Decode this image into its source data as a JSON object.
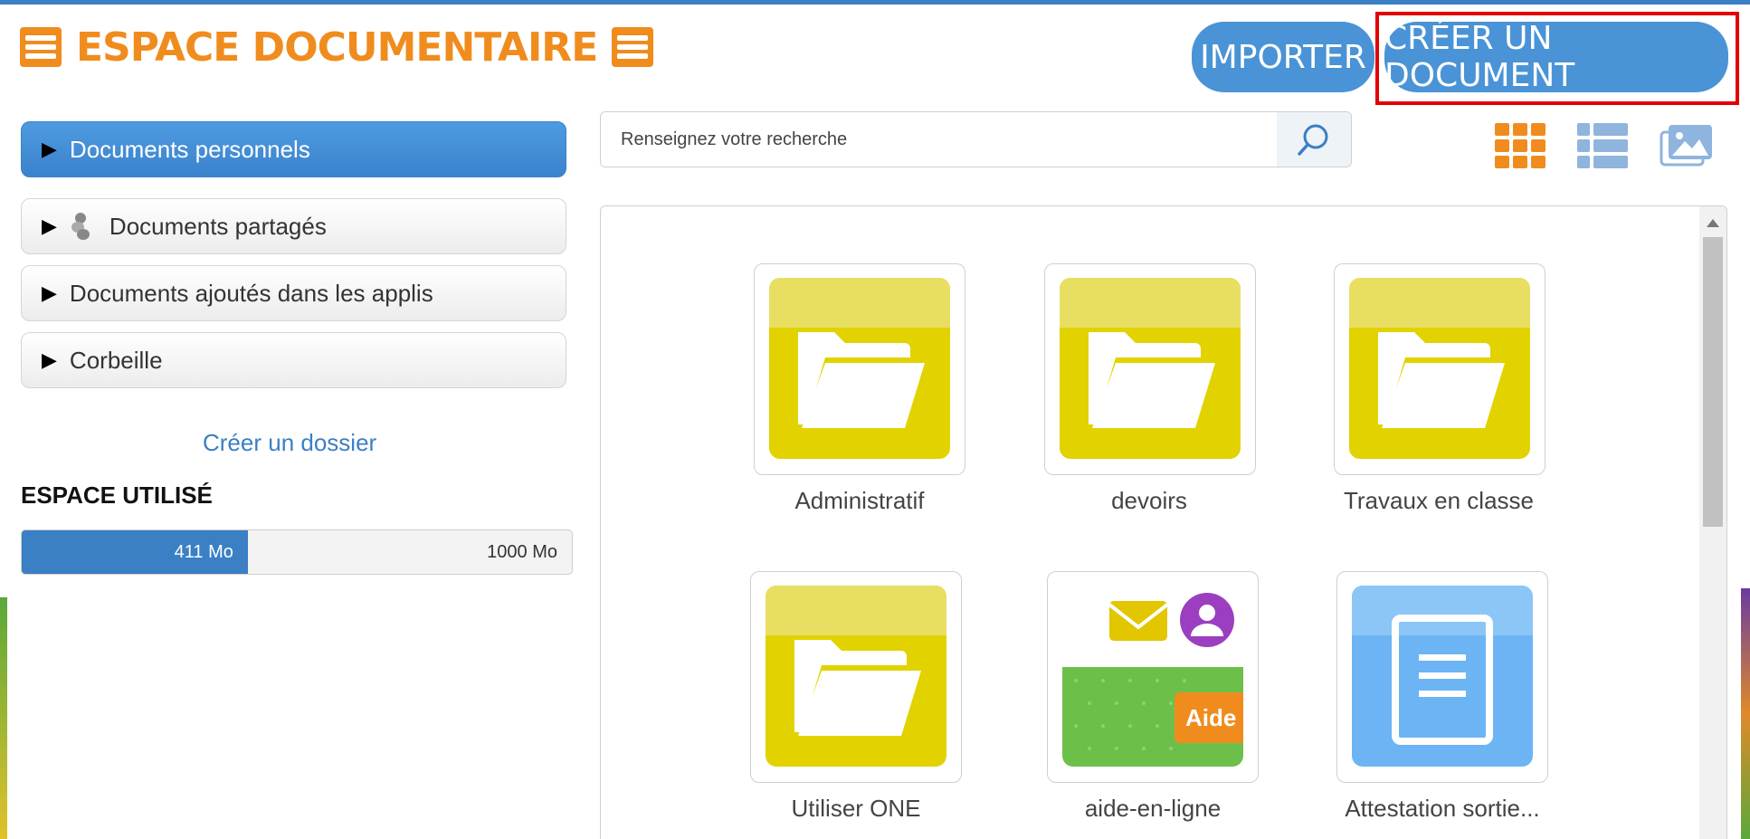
{
  "header": {
    "title": "ESPACE DOCUMENTAIRE",
    "import_label": "IMPORTER",
    "create_label": "CRÉER UN DOCUMENT"
  },
  "sidebar": {
    "items": [
      {
        "label": "Documents personnels",
        "active": true
      },
      {
        "label": "Documents partagés",
        "icon": "share-icon"
      },
      {
        "label": "Documents ajoutés dans les applis"
      },
      {
        "label": "Corbeille"
      }
    ],
    "create_folder_label": "Créer un dossier",
    "space_title": "ESPACE UTILISÉ",
    "used_label": "411 Mo",
    "max_label": "1000 Mo",
    "used_fraction": 0.411
  },
  "search": {
    "placeholder": "Renseignez votre recherche"
  },
  "view_modes": [
    "grid-view-icon",
    "list-view-icon",
    "gallery-view-icon"
  ],
  "items": [
    {
      "label": "Administratif",
      "type": "folder"
    },
    {
      "label": "devoirs",
      "type": "folder"
    },
    {
      "label": "Travaux en classe",
      "type": "folder"
    },
    {
      "label": "Utiliser ONE",
      "type": "folder"
    },
    {
      "label": "aide-en-ligne",
      "type": "image",
      "badge": "Aide"
    },
    {
      "label": "Attestation sortie...",
      "type": "document"
    }
  ],
  "colors": {
    "accent_orange": "#f08c1e",
    "primary_blue": "#4a93d6",
    "folder_yellow": "#e1d200",
    "highlight_red": "#e30000"
  }
}
